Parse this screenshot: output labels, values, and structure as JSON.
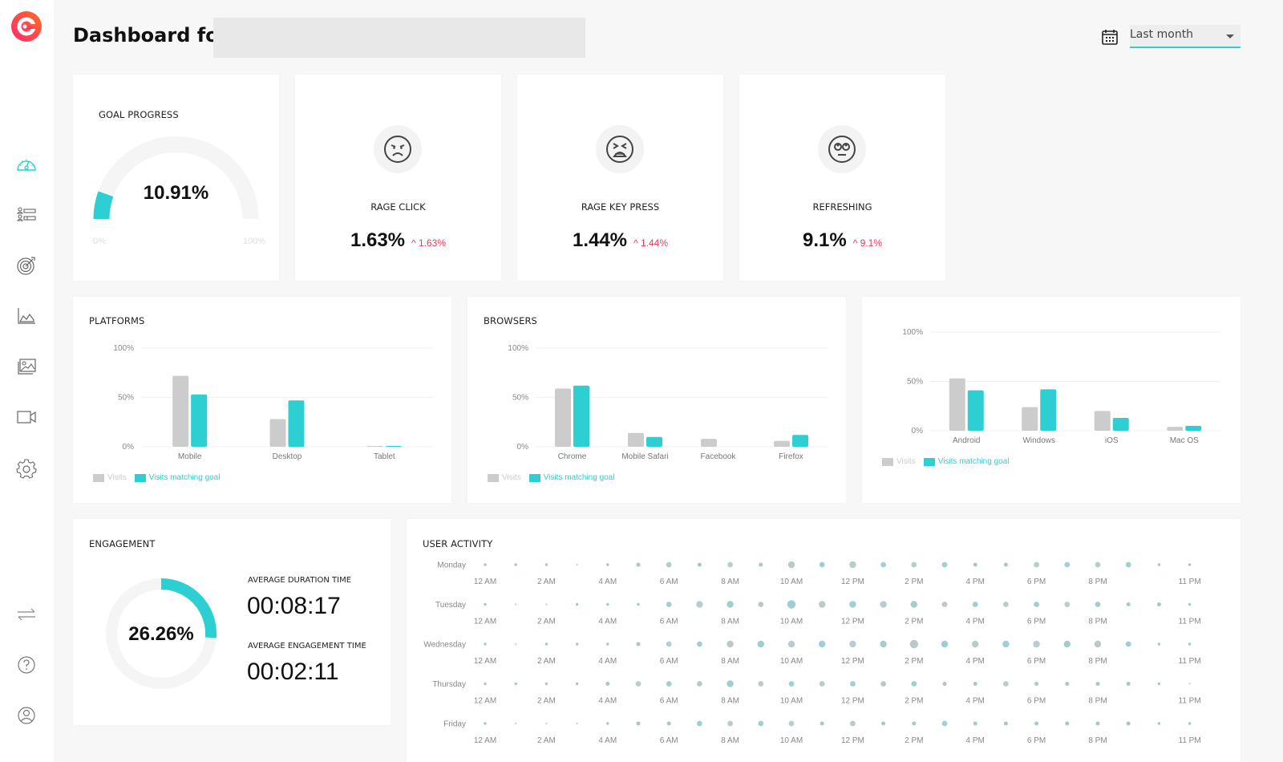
{
  "header": {
    "title": "Dashboard for",
    "date_range": {
      "selected": "Last month"
    }
  },
  "sidebar": {
    "top_items": [
      {
        "name": "dashboard",
        "active": true
      },
      {
        "name": "users"
      },
      {
        "name": "goals"
      },
      {
        "name": "analytics"
      },
      {
        "name": "heatmaps"
      },
      {
        "name": "recordings"
      },
      {
        "name": "settings"
      }
    ],
    "bottom_items": [
      {
        "name": "switch"
      },
      {
        "name": "help"
      },
      {
        "name": "account"
      }
    ]
  },
  "colors": {
    "accent": "#2dcfd3",
    "visits": "#cccccc",
    "delta_up": "#e8385b",
    "track": "#f5f5f5"
  },
  "goal_progress": {
    "title": "GOAL PROGRESS",
    "value_label": "10.91%",
    "value": 10.91,
    "min_label": "0%",
    "max_label": "100%"
  },
  "metrics": [
    {
      "icon": "angry-face-icon",
      "label": "RAGE CLICK",
      "value": "1.63%",
      "delta": "^ 1.63%"
    },
    {
      "icon": "frustrated-face-icon",
      "label": "RAGE KEY PRESS",
      "value": "1.44%",
      "delta": "^ 1.44%"
    },
    {
      "icon": "eye-roll-face-icon",
      "label": "REFRESHING",
      "value": "9.1%",
      "delta": "^ 9.1%"
    }
  ],
  "chart_data": [
    {
      "type": "bar",
      "title": "PLATFORMS",
      "categories": [
        "Mobile",
        "Desktop",
        "Tablet"
      ],
      "series": [
        {
          "name": "Visits",
          "values": [
            72,
            28,
            0.5
          ]
        },
        {
          "name": "Visits matching goal",
          "values": [
            53,
            47,
            0.5
          ]
        }
      ],
      "yticks": [
        "0%",
        "50%",
        "100%"
      ],
      "ylim": [
        0,
        100
      ],
      "legend": "bottom-left"
    },
    {
      "type": "bar",
      "title": "BROWSERS",
      "categories": [
        "Chrome",
        "Mobile Safari",
        "Facebook",
        "Firefox"
      ],
      "series": [
        {
          "name": "Visits",
          "values": [
            59,
            14,
            8,
            6
          ]
        },
        {
          "name": "Visits matching goal",
          "values": [
            62,
            10,
            0,
            12
          ]
        }
      ],
      "yticks": [
        "0%",
        "50%",
        "100%"
      ],
      "ylim": [
        0,
        100
      ],
      "legend": "bottom-left"
    },
    {
      "type": "bar",
      "title": "",
      "categories": [
        "Android",
        "Windows",
        "iOS",
        "Mac OS"
      ],
      "series": [
        {
          "name": "Visits",
          "values": [
            53,
            24,
            20,
            4
          ]
        },
        {
          "name": "Visits matching goal",
          "values": [
            41,
            42,
            13,
            5
          ]
        }
      ],
      "yticks": [
        "0%",
        "50%",
        "100%"
      ],
      "ylim": [
        0,
        100
      ],
      "legend": "bottom-left"
    }
  ],
  "engagement": {
    "title": "ENGAGEMENT",
    "value_label": "26.26%",
    "value": 26.26,
    "avg_duration_label": "AVERAGE DURATION TIME",
    "avg_duration": "00:08:17",
    "avg_engagement_label": "AVERAGE ENGAGEMENT TIME",
    "avg_engagement": "00:02:11"
  },
  "user_activity": {
    "title": "USER ACTIVITY",
    "hour_labels": [
      "12 AM",
      "",
      "2 AM",
      "",
      "4 AM",
      "",
      "6 AM",
      "",
      "8 AM",
      "",
      "10 AM",
      "",
      "12 PM",
      "",
      "2 PM",
      "",
      "4 PM",
      "",
      "6 PM",
      "",
      "8 PM",
      "",
      "",
      "11 PM"
    ],
    "days": [
      {
        "day": "Monday",
        "levels": [
          1,
          1,
          1,
          0,
          1,
          2,
          3,
          2,
          3,
          2,
          4,
          3,
          4,
          3,
          3,
          3,
          2,
          2,
          3,
          3,
          3,
          3,
          1,
          1
        ]
      },
      {
        "day": "Tuesday",
        "levels": [
          1,
          0,
          0,
          1,
          1,
          1,
          3,
          4,
          4,
          3,
          5,
          4,
          4,
          4,
          4,
          3,
          3,
          3,
          3,
          3,
          3,
          2,
          2,
          1
        ]
      },
      {
        "day": "Wednesday",
        "levels": [
          1,
          0,
          1,
          1,
          1,
          2,
          3,
          3,
          4,
          4,
          4,
          4,
          4,
          4,
          5,
          4,
          4,
          4,
          4,
          4,
          4,
          3,
          1,
          1
        ]
      },
      {
        "day": "Thursday",
        "levels": [
          1,
          1,
          1,
          1,
          2,
          3,
          3,
          3,
          4,
          3,
          3,
          3,
          3,
          3,
          3,
          2,
          2,
          3,
          2,
          2,
          2,
          2,
          1,
          0
        ]
      },
      {
        "day": "Friday",
        "levels": [
          1,
          0,
          0,
          0,
          1,
          2,
          2,
          3,
          3,
          3,
          3,
          2,
          3,
          2,
          2,
          3,
          2,
          2,
          2,
          2,
          2,
          2,
          1,
          1
        ]
      }
    ]
  }
}
